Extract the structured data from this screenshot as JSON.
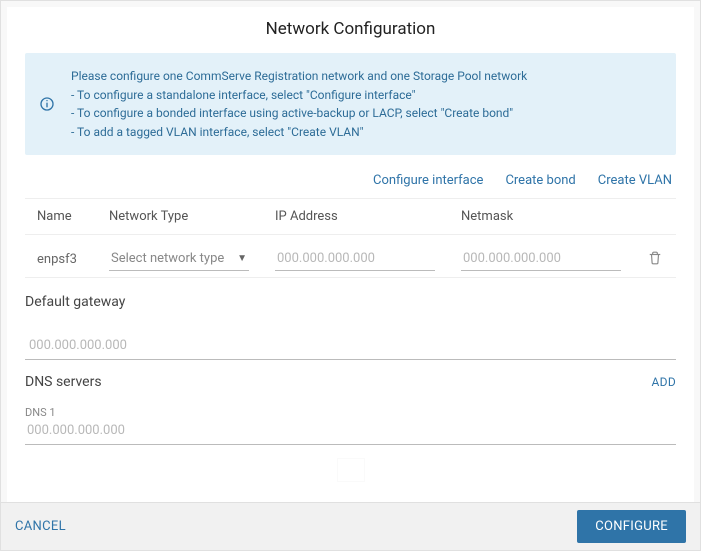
{
  "title": "Network Configuration",
  "alert": {
    "line1": "Please configure one CommServe Registration network and one Storage Pool network",
    "line2": "- To configure a standalone interface, select \"Configure interface\"",
    "line3": "- To configure a bonded interface using active-backup or LACP, select \"Create bond\"",
    "line4": "- To add a tagged VLAN interface, select \"Create VLAN\""
  },
  "actions": {
    "configure_interface": "Configure interface",
    "create_bond": "Create bond",
    "create_vlan": "Create VLAN"
  },
  "table": {
    "headers": {
      "name": "Name",
      "type": "Network Type",
      "ip": "IP Address",
      "netmask": "Netmask"
    },
    "row": {
      "name": "enpsf3",
      "type_placeholder": "Select network type",
      "ip_placeholder": "000.000.000.000",
      "netmask_placeholder": "000.000.000.000",
      "ip_value": "",
      "netmask_value": ""
    }
  },
  "gateway": {
    "label": "Default gateway",
    "placeholder": "000.000.000.000",
    "value": ""
  },
  "dns": {
    "label": "DNS servers",
    "add_label": "ADD",
    "field_label": "DNS 1",
    "placeholder": "000.000.000.000",
    "value": ""
  },
  "footer": {
    "cancel": "CANCEL",
    "configure": "CONFIGURE"
  },
  "colors": {
    "accent": "#2f74a8",
    "info_bg": "#e3f1f9",
    "info_text": "#2d6c97"
  }
}
